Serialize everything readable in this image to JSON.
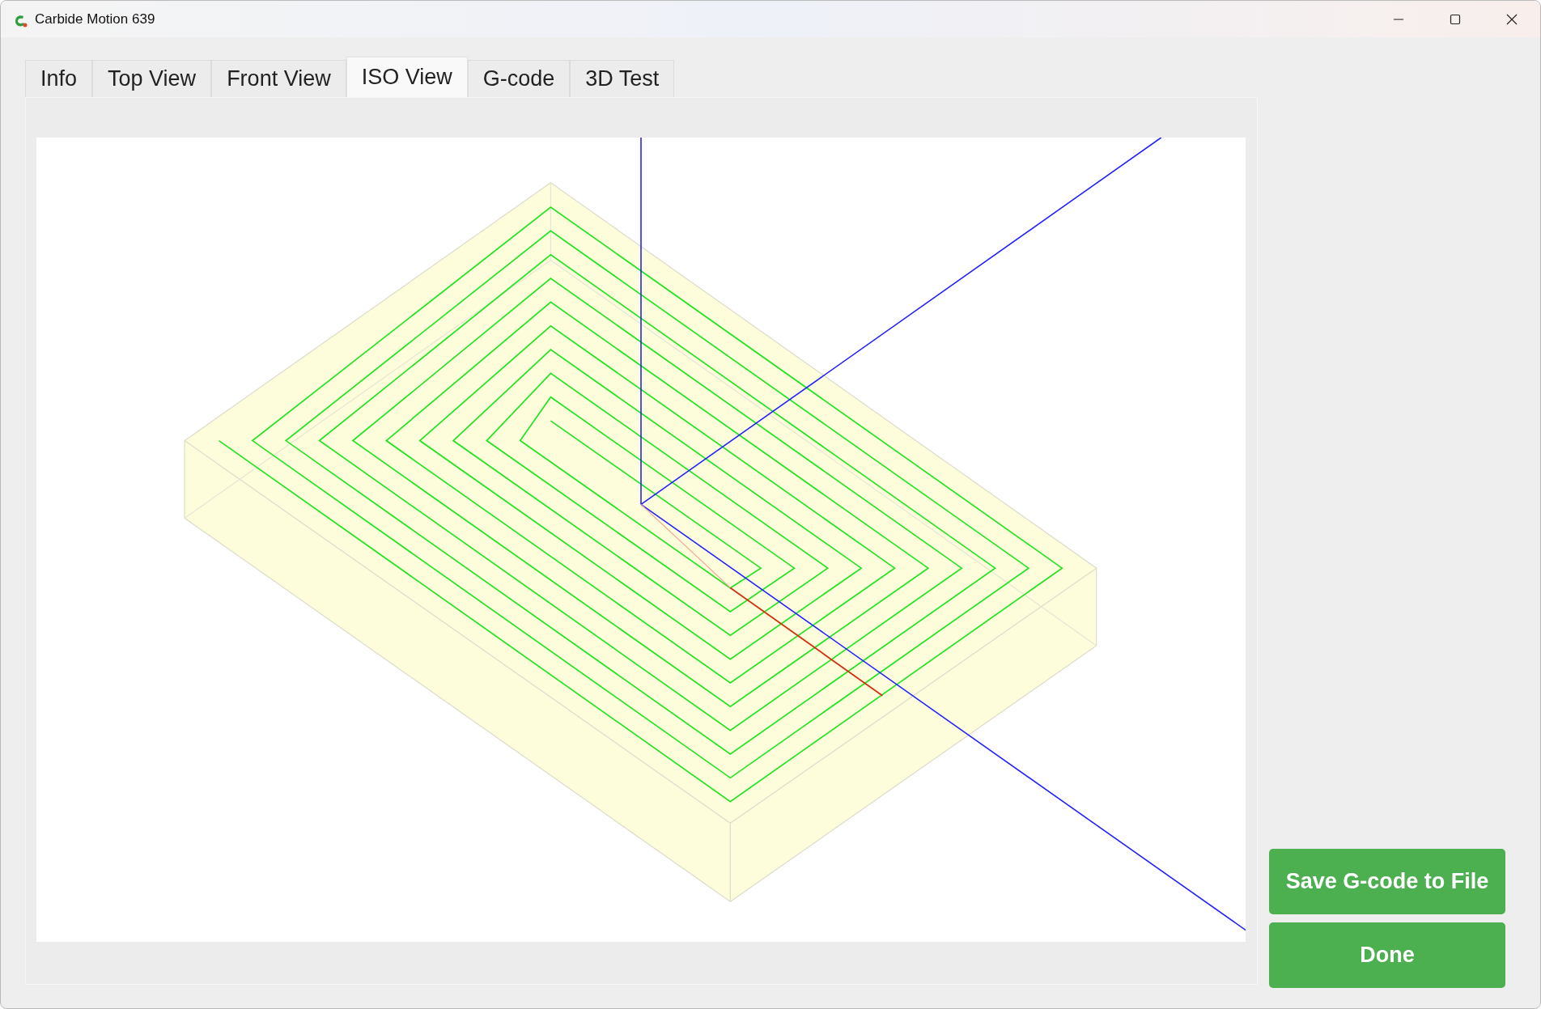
{
  "window": {
    "title": "Carbide Motion 639"
  },
  "tabs": [
    {
      "label": "Info",
      "selected": false
    },
    {
      "label": "Top View",
      "selected": false
    },
    {
      "label": "Front View",
      "selected": false
    },
    {
      "label": "ISO View",
      "selected": true
    },
    {
      "label": "G-code",
      "selected": false
    },
    {
      "label": "3D Test",
      "selected": false
    }
  ],
  "buttons": [
    "Save G-code to File",
    "Done"
  ]
}
